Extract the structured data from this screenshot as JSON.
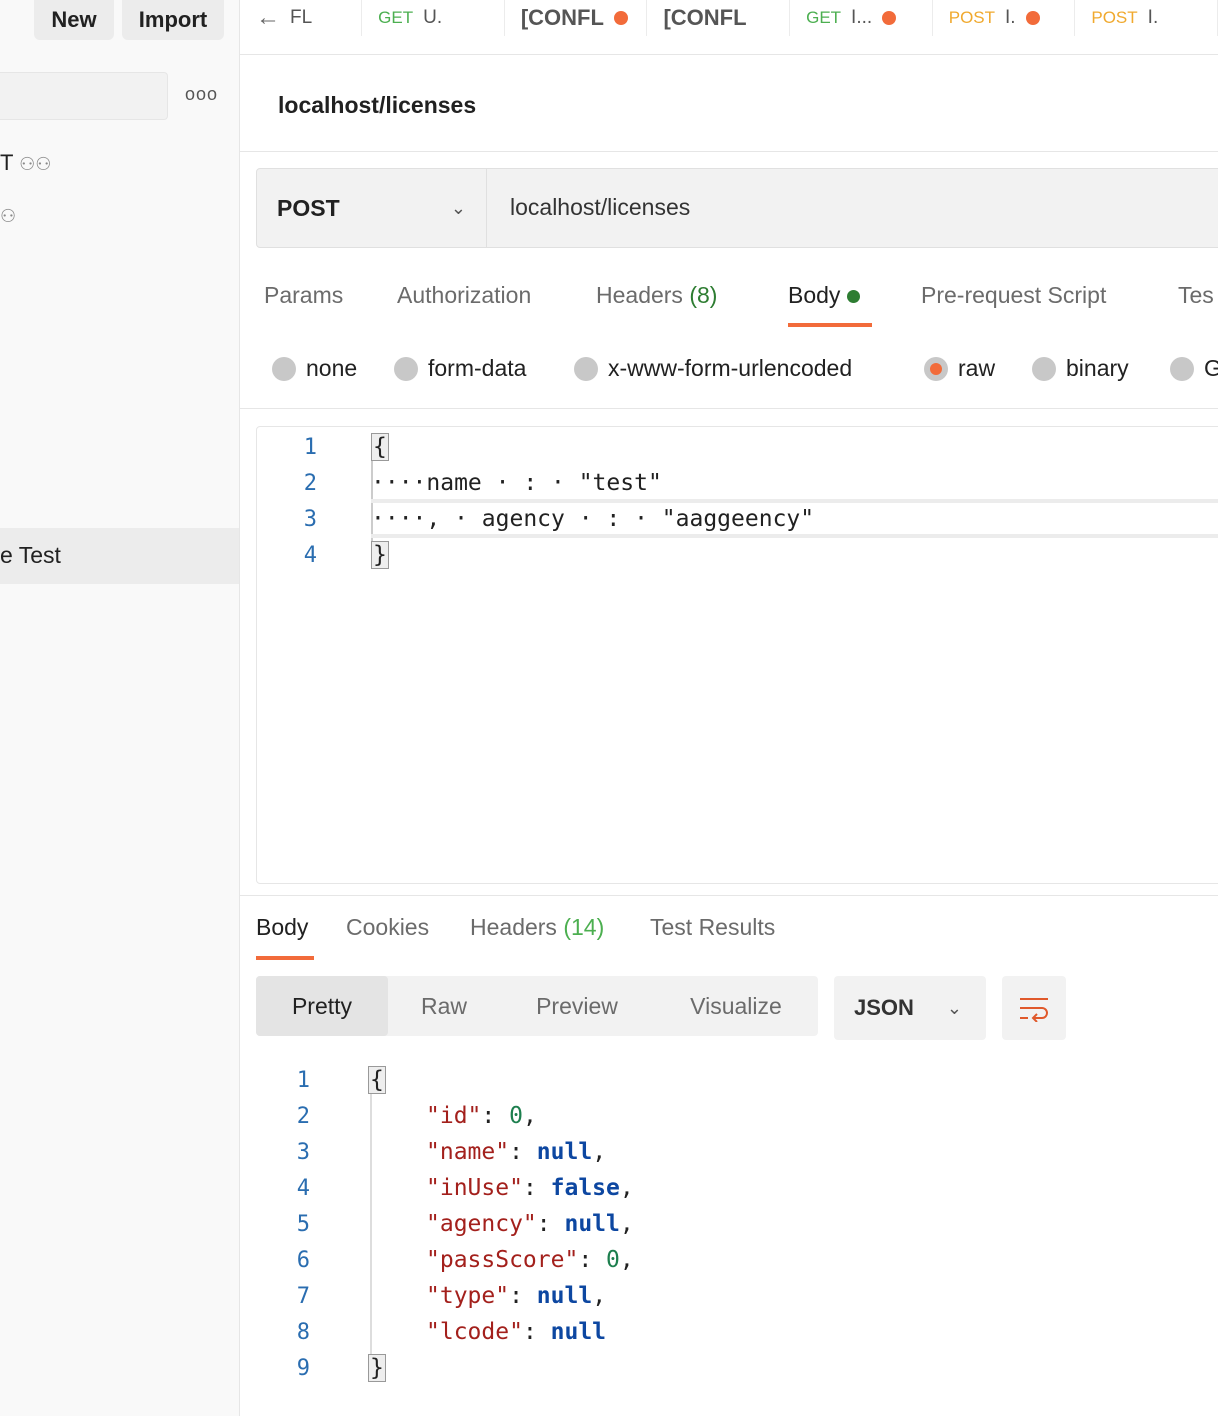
{
  "sidebar": {
    "new_label": "New",
    "import_label": "Import",
    "more": "ooo",
    "item1": "T",
    "item_selected": "e Test"
  },
  "tabs": [
    {
      "method": "",
      "label": "FL",
      "back": "←"
    },
    {
      "method": "GET",
      "label": "U.",
      "dot": false
    },
    {
      "method": "",
      "label": "[CONFL",
      "dot": true
    },
    {
      "method": "",
      "label": "[CONFL",
      "dot": false
    },
    {
      "method": "GET",
      "label": "I...",
      "dot": true
    },
    {
      "method": "POST",
      "label": "I.",
      "dot": true
    },
    {
      "method": "POST",
      "label": "I.",
      "dot": false
    }
  ],
  "colors": {
    "get": "#4caf50",
    "post": "#f0a92e",
    "accent": "#f26b3a",
    "body_dot": "#2e7d32"
  },
  "request": {
    "title": "localhost/licenses",
    "method": "POST",
    "url": "localhost/licenses"
  },
  "req_tabs": {
    "params": "Params",
    "authorization": "Authorization",
    "headers": "Headers",
    "headers_count": "(8)",
    "body": "Body",
    "prerequest": "Pre-request Script",
    "tests": "Tes"
  },
  "body_types": {
    "none": "none",
    "form_data": "form-data",
    "urlencoded": "x-www-form-urlencoded",
    "raw": "raw",
    "binary": "binary",
    "graphql": "G",
    "selected": "raw"
  },
  "request_body": [
    {
      "n": "1",
      "t": "{"
    },
    {
      "n": "2",
      "t": "····name · : · \"test\""
    },
    {
      "n": "3",
      "t": "····, · agency · : · \"aaggeency\""
    },
    {
      "n": "4",
      "t": "}"
    }
  ],
  "resp_tabs": {
    "body": "Body",
    "cookies": "Cookies",
    "headers": "Headers",
    "headers_count": "(14)",
    "tests": "Test Results"
  },
  "view": {
    "pretty": "Pretty",
    "raw": "Raw",
    "preview": "Preview",
    "visualize": "Visualize",
    "format": "JSON"
  },
  "response": [
    {
      "n": "1"
    },
    {
      "n": "2",
      "k": "\"id\"",
      "v": "0",
      "type": "num",
      "c": ","
    },
    {
      "n": "3",
      "k": "\"name\"",
      "v": "null",
      "type": "kw",
      "c": ","
    },
    {
      "n": "4",
      "k": "\"inUse\"",
      "v": "false",
      "type": "kw",
      "c": ","
    },
    {
      "n": "5",
      "k": "\"agency\"",
      "v": "null",
      "type": "kw",
      "c": ","
    },
    {
      "n": "6",
      "k": "\"passScore\"",
      "v": "0",
      "type": "num",
      "c": ","
    },
    {
      "n": "7",
      "k": "\"type\"",
      "v": "null",
      "type": "kw",
      "c": ","
    },
    {
      "n": "8",
      "k": "\"lcode\"",
      "v": "null",
      "type": "kw",
      "c": ""
    },
    {
      "n": "9"
    }
  ]
}
